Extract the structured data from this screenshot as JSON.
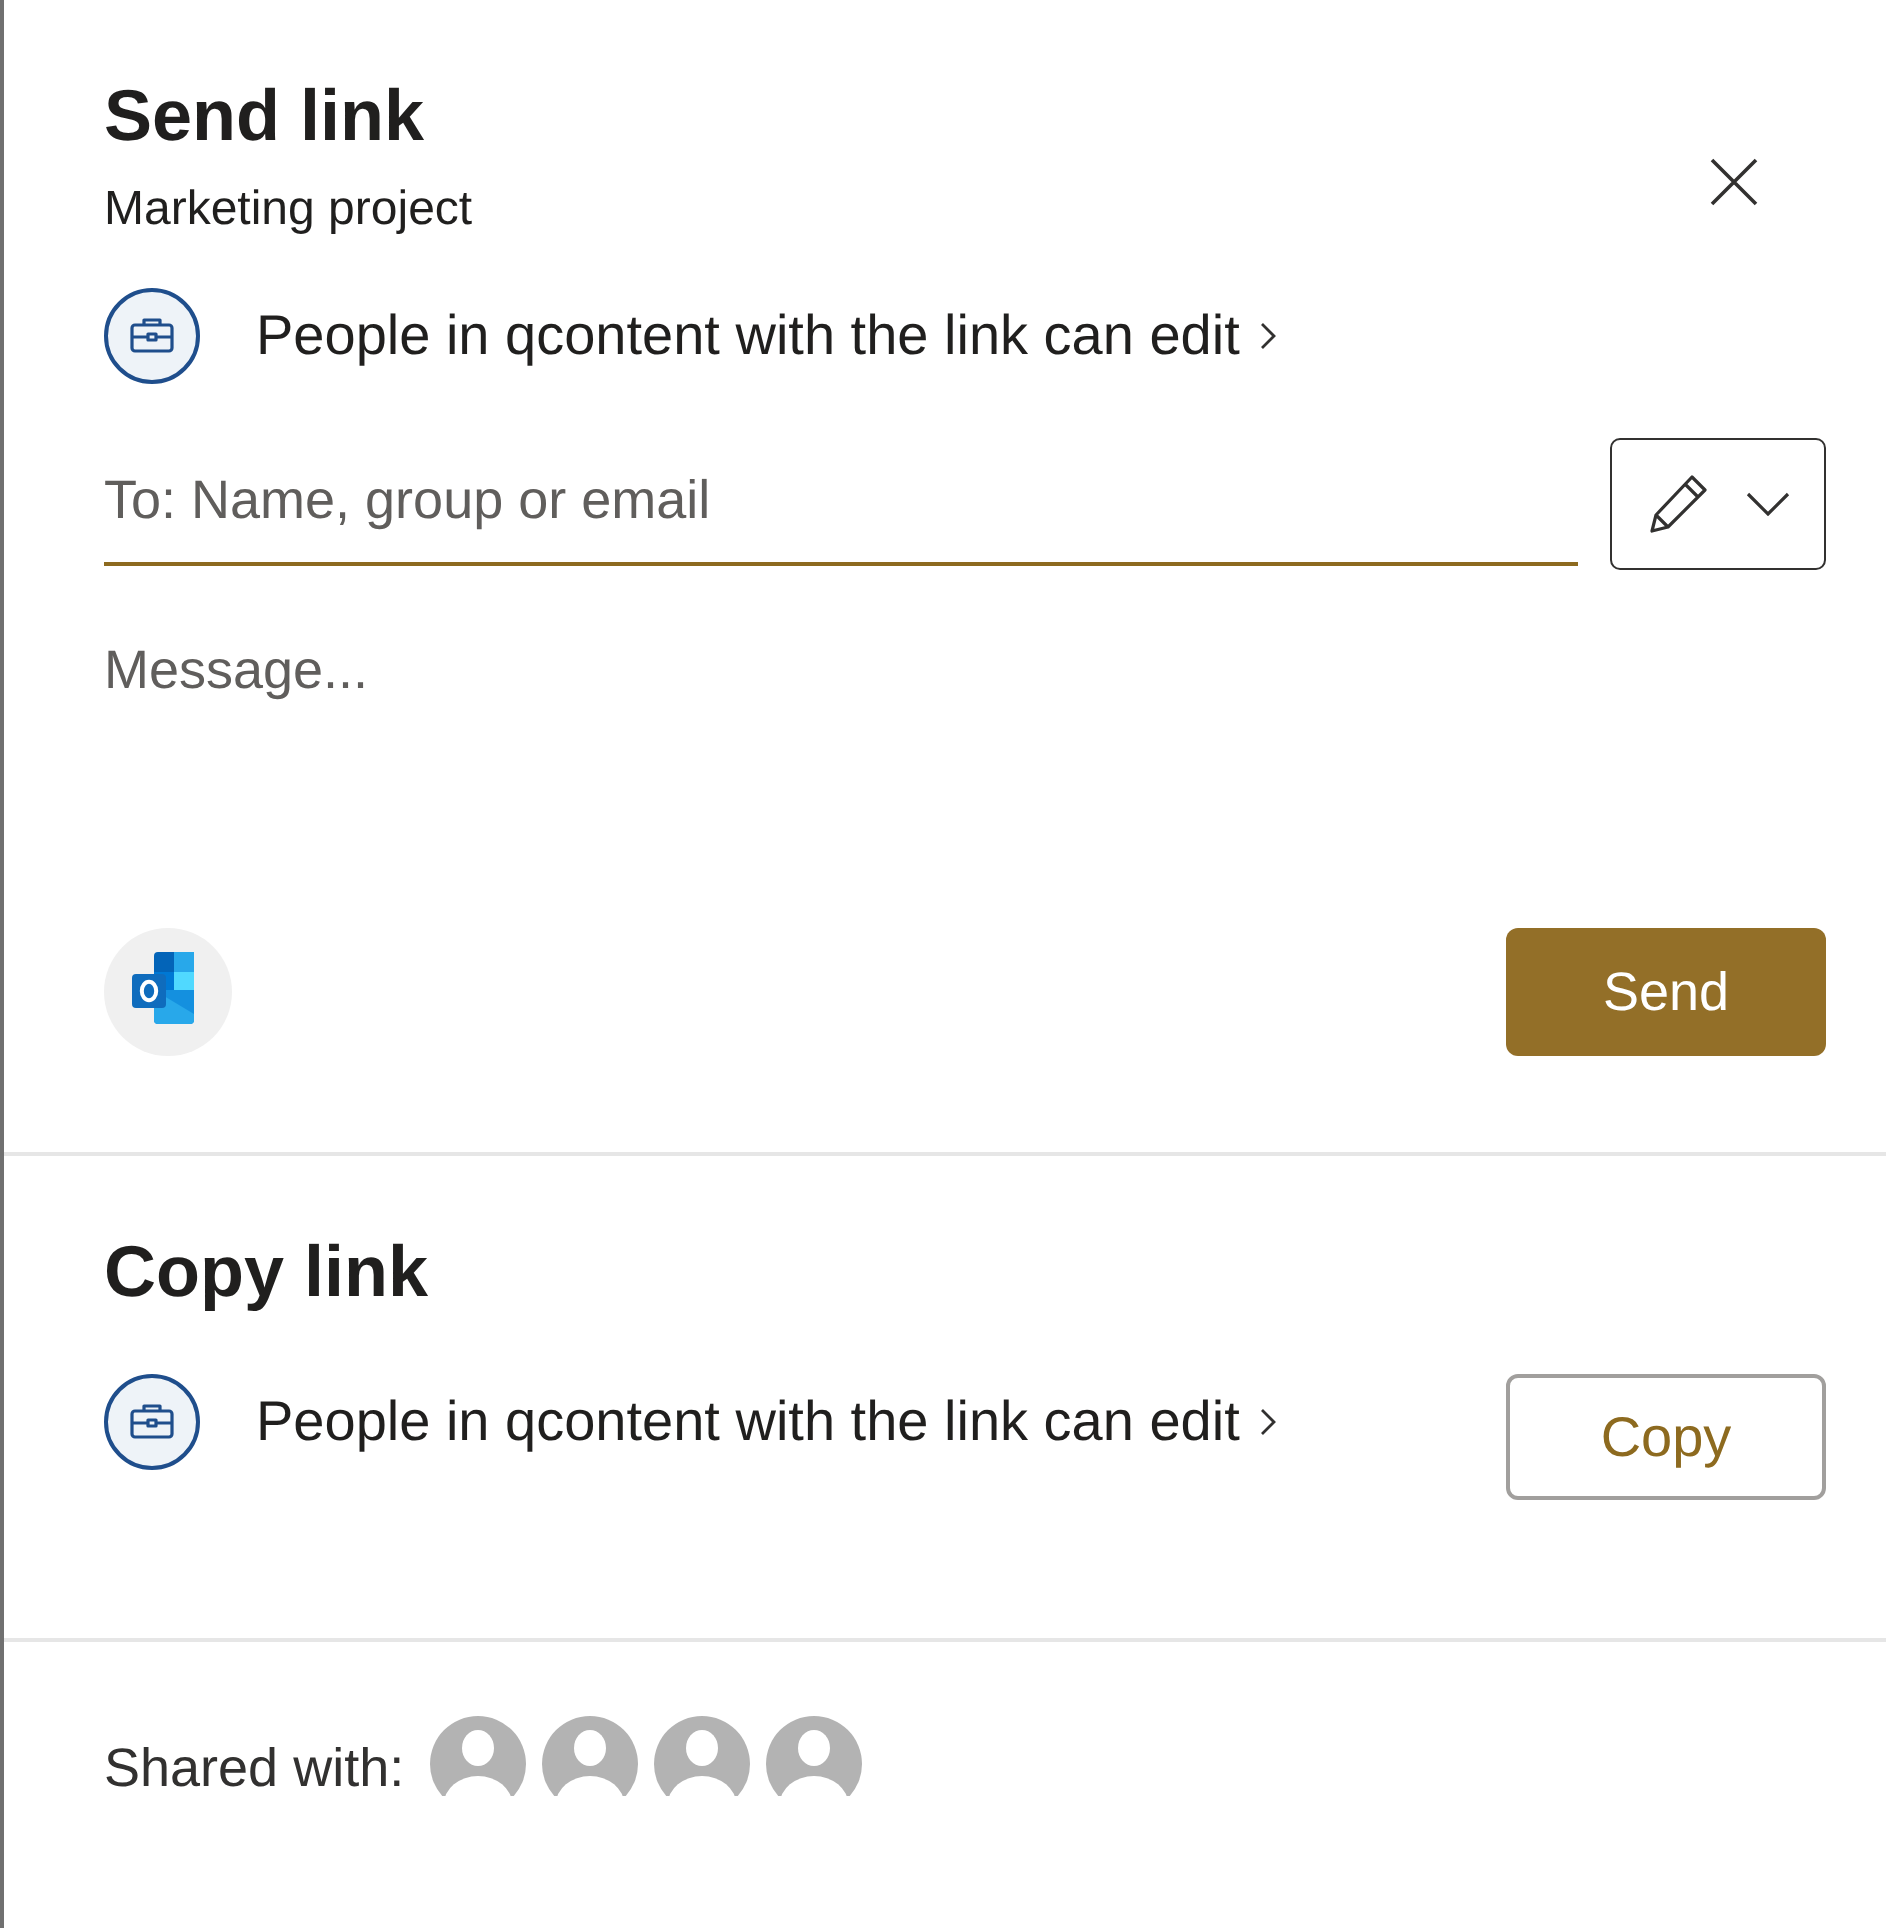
{
  "dialog": {
    "title": "Send link",
    "subtitle": "Marketing project"
  },
  "send_link": {
    "permission": {
      "text": "People in qcontent with the link can edit"
    },
    "to_field": {
      "placeholder": "To: Name, group or email",
      "focused": true
    },
    "message_field": {
      "placeholder": "Message...",
      "focused": false
    },
    "send_button": "Send"
  },
  "copy_link": {
    "title": "Copy link",
    "permission": {
      "text": "People in qcontent with the link can edit"
    },
    "copy_button": "Copy"
  },
  "shared_with": {
    "label": "Shared with:",
    "people": [
      {
        "kind": "silhouette"
      },
      {
        "kind": "silhouette"
      },
      {
        "kind": "silhouette"
      },
      {
        "kind": "silhouette"
      }
    ]
  }
}
